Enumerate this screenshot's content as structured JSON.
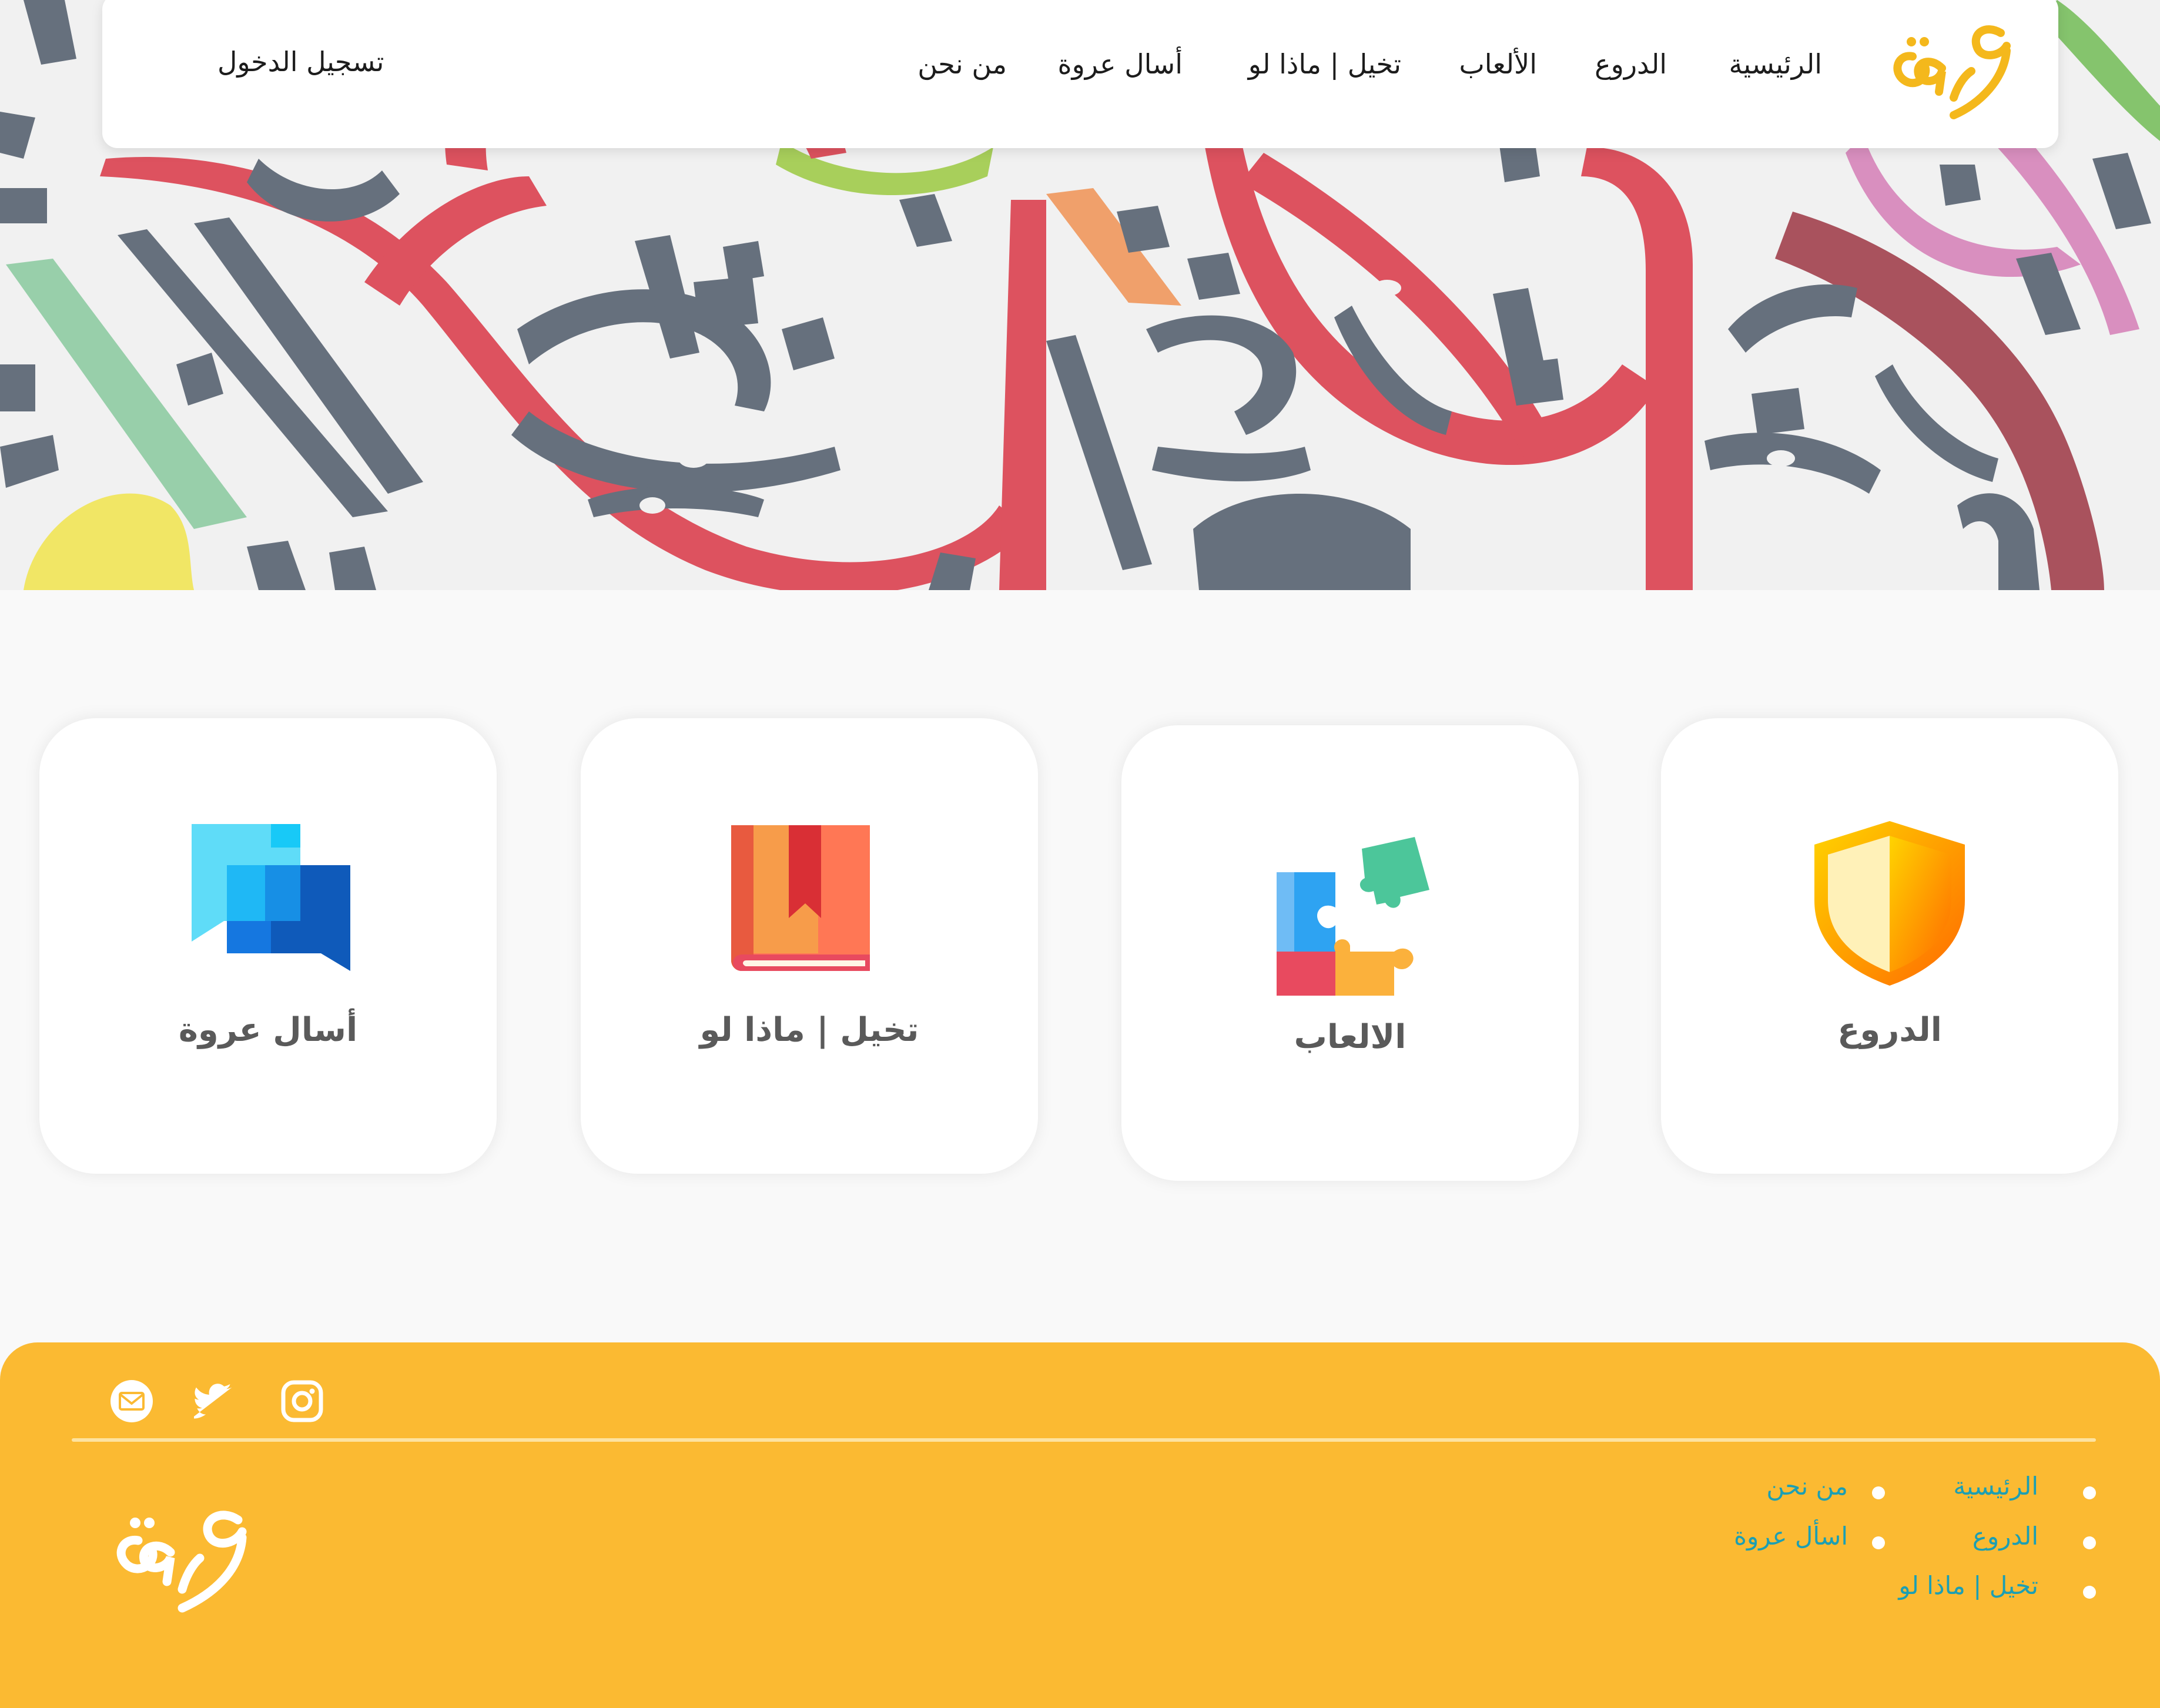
{
  "brand": {
    "logo_text": "عروة"
  },
  "nav": {
    "items": [
      "الرئيسية",
      "الدروع",
      "الألعاب",
      "تخيل | ماذا لو",
      "أسال عروة",
      "من نحن"
    ],
    "login": "تسجيل الدخول"
  },
  "cards": [
    {
      "label": "الدروع",
      "icon": "shield-icon"
    },
    {
      "label": "الالعاب",
      "icon": "puzzle-icon"
    },
    {
      "label": "تخيل | ماذا لو",
      "icon": "book-icon"
    },
    {
      "label": "أسال عروة",
      "icon": "chat-bubbles-icon"
    }
  ],
  "footer": {
    "social": [
      "instagram-icon",
      "twitter-icon",
      "email-icon"
    ],
    "links_col1": [
      "الرئيسية",
      "الدروع",
      "تخيل | ماذا لو"
    ],
    "links_col2": [
      "من نحن",
      "اسأل عروة"
    ]
  },
  "colors": {
    "footer_bg": "#fbba32",
    "footer_link": "#1c9fb3",
    "logo_gold": "#f4b81c",
    "hero_red": "#dd525f",
    "hero_slate": "#66707d"
  }
}
